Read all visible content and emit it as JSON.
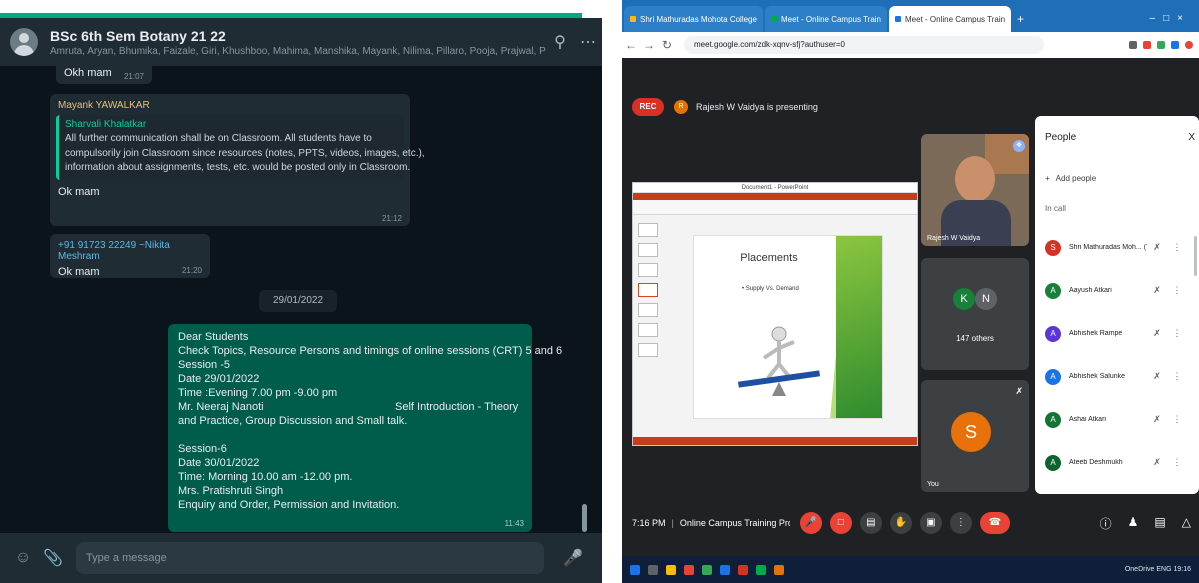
{
  "whatsapp": {
    "header": {
      "title": "BSc 6th Sem Botany 21 22",
      "members": "Amruta, Aryan, Bhumika, Faizale, Giri, Khushboo, Mahima, Manshika, Mayank, Nilima, Pillaro, Pooja, Prajwal, Pra..."
    },
    "messages": [
      {
        "text": "Okh mam",
        "time": "21:07"
      },
      {
        "sender": "Mayank YAWALKAR",
        "quote_name": "Sharvali Khalatkar",
        "quote_lines": [
          "All further communication shall be on Classroom. All students have to",
          "compulsorily join Classroom since resources (notes, PPTS, videos, images, etc.),",
          "information about assignments, tests, etc. would be posted only in Classroom."
        ],
        "text": "Ok mam",
        "time": "21:12"
      },
      {
        "sender": "+91 91723 22249 ~Nikita Meshram",
        "text": "Ok mam",
        "time": "21:20"
      }
    ],
    "date_chip": "29/01/2022",
    "outgoing": {
      "lines": [
        "Dear Students",
        "Check Topics, Resource Persons and timings of online sessions (CRT) 5 and 6",
        "Session -5",
        "Date 29/01/2022",
        "Time :Evening 7.00 pm  -9.00 pm",
        "Mr. Neeraj Nanoti                                           Self Introduction - Theory",
        "and Practice, Group Discussion and Small talk.",
        "",
        "Session-6",
        "Date 30/01/2022",
        "Time: Morning 10.00 am  -12.00 pm.",
        "Mrs. Pratishruti Singh",
        "Enquiry and Order, Permission and Invitation."
      ],
      "time": "11:43"
    },
    "input_placeholder": "Type a message"
  },
  "meet": {
    "tabs": [
      "Shri Mathuradas Mohota College",
      "Meet - Online Campus Train",
      "Meet - Online Campus Train"
    ],
    "url": "meet.google.com/zdk-xqnv-sfj?authuser=0",
    "rec_label": "REC",
    "presenting_initial": "R",
    "presenting_text": "Rajesh W Vaidya is presenting",
    "ppt_title": "Document1 - PowerPoint",
    "slide": {
      "title": "Placements",
      "bullet": "• Supply Vs. Demand"
    },
    "video_name": "Rajesh W Vaidya",
    "kn": {
      "k": "K",
      "n": "N",
      "others": "147 others"
    },
    "you": {
      "initial": "S",
      "label": "You"
    },
    "people": {
      "title": "People",
      "close": "X",
      "add": "Add people",
      "incall": "In call",
      "list": [
        {
          "initial": "S",
          "name": "Shri Mathuradas Moh... (You)",
          "color": "#d93025"
        },
        {
          "initial": "A",
          "name": "Aayush Atkari",
          "color": "#188038"
        },
        {
          "initial": "A",
          "name": "Abhishek Rampe",
          "color": "#5b36d6"
        },
        {
          "initial": "A",
          "name": "Abhishek Salunke",
          "color": "#1a73e8"
        },
        {
          "initial": "A",
          "name": "Ashai Atkari",
          "color": "#137333"
        },
        {
          "initial": "A",
          "name": "Ateeb Deshmukh",
          "color": "#0d652d"
        },
        {
          "initial": "A",
          "name": "",
          "color": "#e37400"
        }
      ]
    },
    "bottom": {
      "time": "7:16 PM",
      "meeting": "Online Campus Training Programme (CRT) J..."
    },
    "tray": "OneDrive  ENG  19:16"
  },
  "colors": {
    "wa_bg": "#0b141a",
    "wa_accent": "#00a884",
    "meet_bg": "#202124",
    "meet_red": "#ea4335"
  }
}
